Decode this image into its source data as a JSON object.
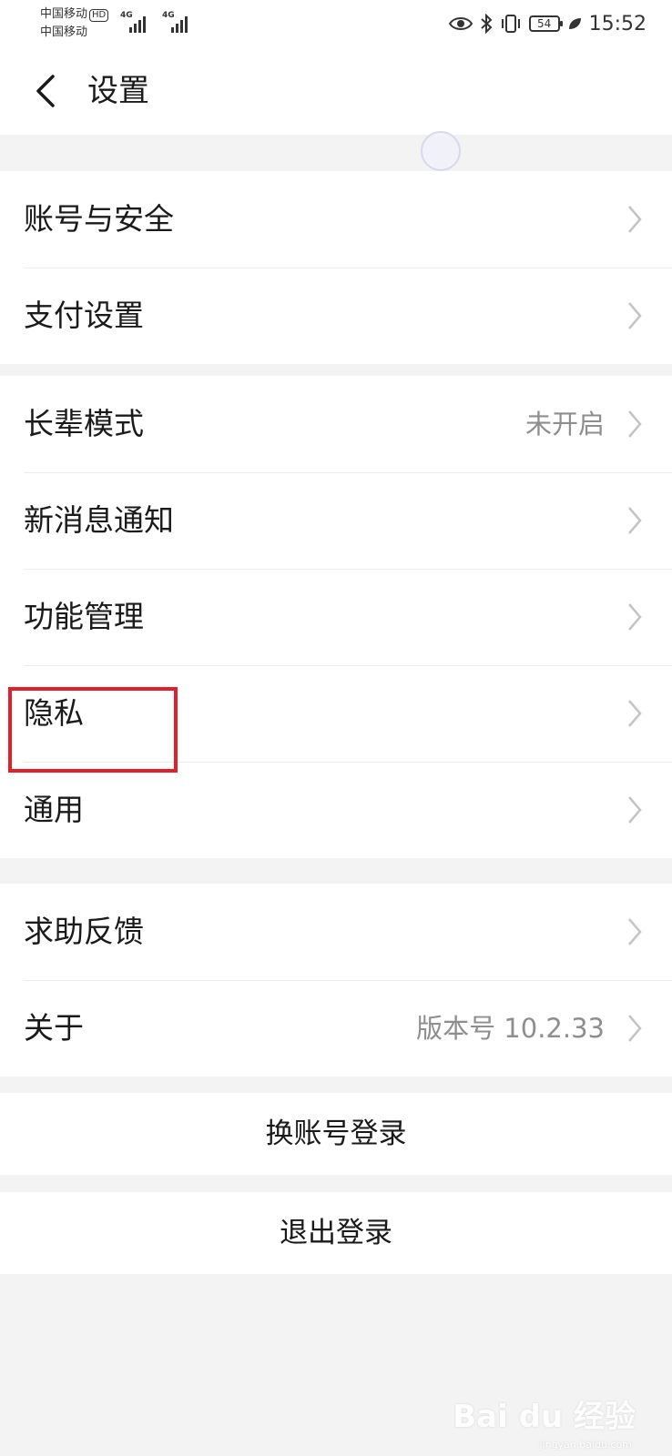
{
  "status_bar": {
    "carrier_1": "中国移动",
    "hd_badge": "HD",
    "carrier_2": "中国移动",
    "network_1": "4G",
    "network_2": "4G",
    "battery": "54",
    "time": "15:52",
    "icons": [
      "eye-icon",
      "bluetooth-icon",
      "vibrate-icon",
      "battery-icon",
      "leaf-icon"
    ]
  },
  "header": {
    "title": "设置"
  },
  "groups": [
    {
      "items": [
        {
          "label": "账号与安全",
          "value": ""
        },
        {
          "label": "支付设置",
          "value": ""
        }
      ]
    },
    {
      "items": [
        {
          "label": "长辈模式",
          "value": "未开启"
        },
        {
          "label": "新消息通知",
          "value": ""
        },
        {
          "label": "功能管理",
          "value": ""
        },
        {
          "label": "隐私",
          "value": ""
        },
        {
          "label": "通用",
          "value": ""
        }
      ]
    },
    {
      "items": [
        {
          "label": "求助反馈",
          "value": ""
        },
        {
          "label": "关于",
          "value": "版本号 10.2.33"
        }
      ]
    }
  ],
  "actions": {
    "switch_account": "换账号登录",
    "logout": "退出登录"
  },
  "watermark": {
    "text": "Bai du 经验",
    "sub": "jingyan.baidu.com"
  },
  "colors": {
    "highlight": "#e0202a",
    "secondary_text": "#8e8e8e",
    "background": "#f3f3f3"
  }
}
